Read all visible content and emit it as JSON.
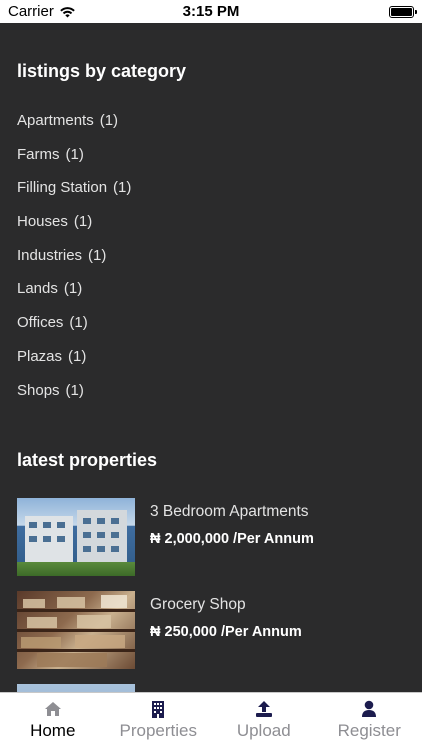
{
  "status": {
    "carrier": "Carrier",
    "time": "3:15 PM"
  },
  "categories_section": {
    "title": "listings by category",
    "items": [
      {
        "label": "Apartments",
        "count": "(1)"
      },
      {
        "label": "Farms",
        "count": "(1)"
      },
      {
        "label": "Filling Station",
        "count": "(1)"
      },
      {
        "label": "Houses",
        "count": "(1)"
      },
      {
        "label": "Industries",
        "count": "(1)"
      },
      {
        "label": "Lands",
        "count": "(1)"
      },
      {
        "label": "Offices",
        "count": "(1)"
      },
      {
        "label": "Plazas",
        "count": "(1)"
      },
      {
        "label": "Shops",
        "count": "(1)"
      }
    ]
  },
  "properties_section": {
    "title": "latest properties",
    "items": [
      {
        "title": "3 Bedroom Apartments",
        "price": "₦ 2,000,000 /Per Annum"
      },
      {
        "title": "Grocery Shop",
        "price": "₦ 250,000 /Per Annum"
      }
    ]
  },
  "tabs": [
    {
      "label": "Home",
      "icon": "home-icon"
    },
    {
      "label": "Properties",
      "icon": "building-icon"
    },
    {
      "label": "Upload",
      "icon": "upload-icon"
    },
    {
      "label": "Register",
      "icon": "user-icon"
    }
  ],
  "colors": {
    "background": "#2b2b2c",
    "tab_icon": "#1c1c4e",
    "tab_inactive": "#8e8e93"
  }
}
